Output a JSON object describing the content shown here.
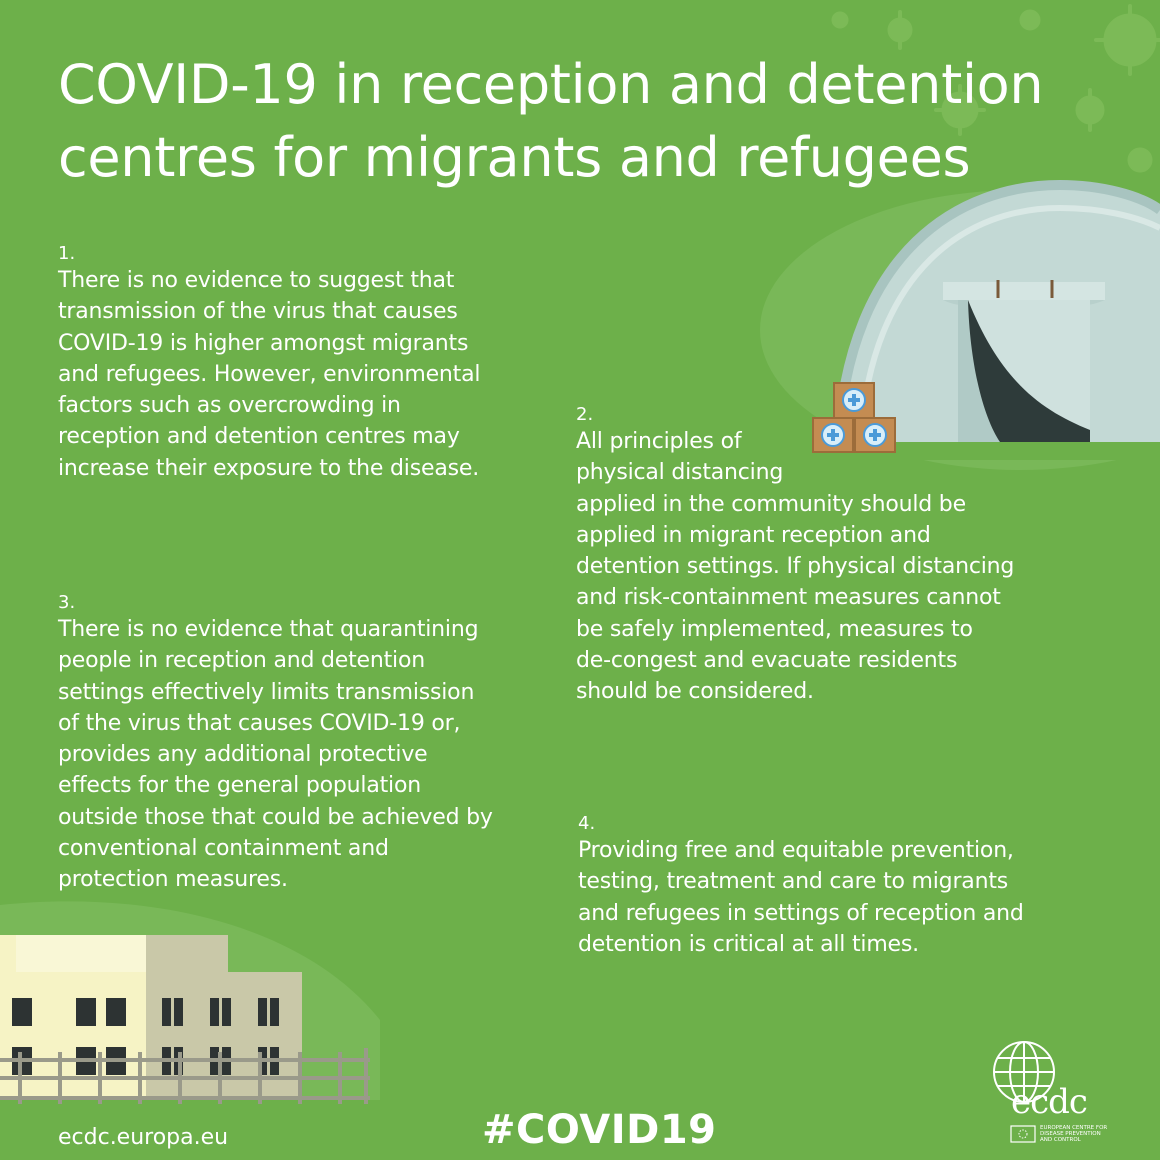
{
  "title_line1": "COVID-19 in reception and detention",
  "title_line2": "centres for migrants and refugees",
  "points": [
    {
      "number": "1.",
      "text": "There is no evidence to suggest that\ntransmission of the virus that causes\nCOVID-19 is higher amongst migrants\nand refugees. However, environmental\nfactors such as overcrowding in\nreception and detention centres may\nincrease their exposure to the disease."
    },
    {
      "number": "2.",
      "text": "All principles of\nphysical distancing\napplied in the community should be\napplied in migrant reception and\ndetention settings. If physical distancing\nand risk-containment measures cannot\nbe safely implemented, measures to\nde-congest and evacuate residents\nshould be considered."
    },
    {
      "number": "3.",
      "text": "There is no evidence that quarantining\npeople in reception and detention\nsettings effectively limits transmission\nof the virus that causes COVID-19 or,\nprovides any additional protective\neffects for the general population\noutside those that could be achieved by\nconventional containment and\nprotection measures."
    },
    {
      "number": "4.",
      "text": "Providing free and equitable prevention,\ntesting, treatment and care to migrants\nand refugees in settings of reception and\ndetention is critical at all times."
    }
  ],
  "footer": {
    "website": "ecdc.europa.eu",
    "hashtag": "#COVID19"
  },
  "logo": {
    "wordmark": "ecdc",
    "line1": "EUROPEAN CENTRE FOR",
    "line2": "DISEASE PREVENTION",
    "line3": "AND CONTROL"
  },
  "colors": {
    "background": "#6db04a",
    "text": "#ffffff",
    "tent": "#c6dcd8",
    "supply_box": "#c08a50",
    "medical_cross": "#4a9ad8",
    "building_light": "#f7f4c8",
    "building_grey": "#c8c7a6"
  },
  "icons": [
    "virus-pattern",
    "tent-illustration",
    "supply-boxes-icon",
    "building-illustration",
    "fence-illustration",
    "ecdc-globe-icon",
    "eu-flag-icon"
  ]
}
